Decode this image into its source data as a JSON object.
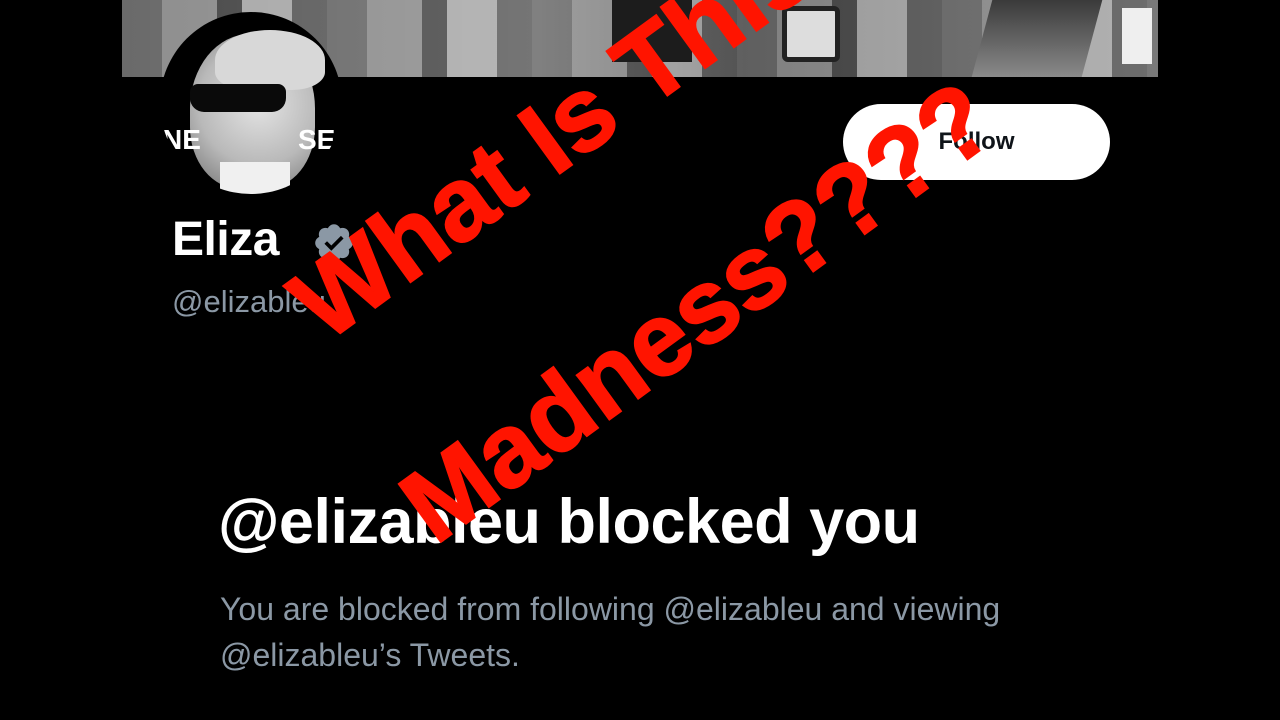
{
  "profile": {
    "display_name": "Eliza",
    "handle": "@elizableu",
    "follow_label": "Follow",
    "avatar_text_left": "NE",
    "avatar_text_right": "SE"
  },
  "blocked": {
    "title": "@elizableu blocked you",
    "description": "You are blocked from following @elizableu and viewing @elizableu’s Tweets."
  },
  "overlay": {
    "line1": "What Is This",
    "line2": "Madness????",
    "color": "#ff1400"
  },
  "colors": {
    "background": "#000000",
    "secondary_text": "#8b98a5",
    "verified_badge": "#8b98a5"
  },
  "icons": {
    "verified": "verified-badge-icon"
  }
}
